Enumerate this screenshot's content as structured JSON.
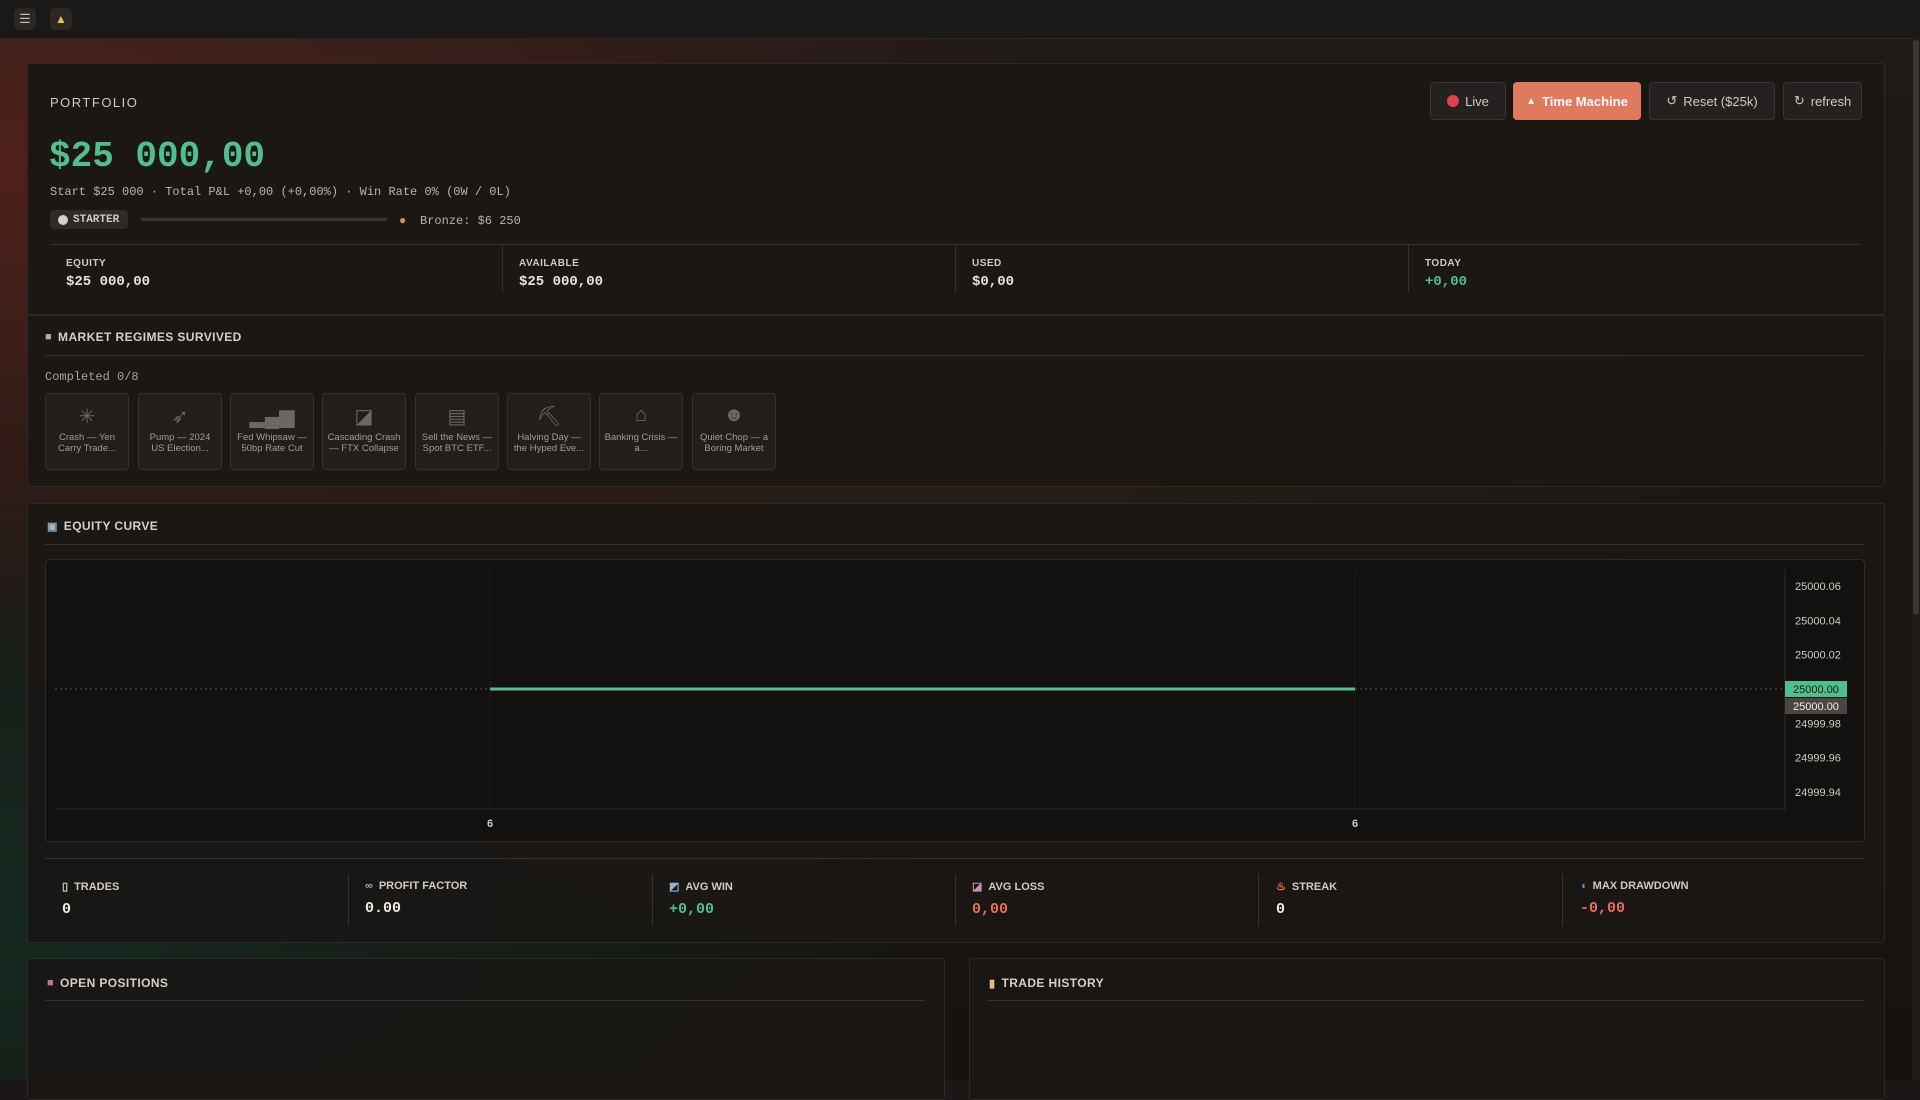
{
  "topbar": {
    "menu_icon": "☰",
    "bell_icon": "🔔"
  },
  "portfolio": {
    "title": "PORTFOLIO",
    "balance": "$25 000,00",
    "summary": "Start $25 000 · Total P&L +0,00 (+0,00%) · Win Rate 0% (0W / 0L)",
    "tier_badge": "STARTER",
    "tier_progress": 0,
    "next_tier": "Bronze: $6 250",
    "buttons": {
      "live": "Live",
      "time_machine": "Time Machine",
      "reset": "Reset ($25k)",
      "refresh": "refresh"
    },
    "metrics": [
      {
        "label": "EQUITY",
        "value": "$25 000,00"
      },
      {
        "label": "AVAILABLE",
        "value": "$25 000,00"
      },
      {
        "label": "USED",
        "value": "$0,00"
      },
      {
        "label": "TODAY",
        "value": "+0,00"
      }
    ]
  },
  "regimes": {
    "title": "MARKET REGIMES SURVIVED",
    "completed": "Completed 0/8",
    "items": [
      {
        "line1": "Crash — Yen",
        "line2": "Carry Trade...",
        "icon": "spark-icon"
      },
      {
        "line1": "Pump — 2024",
        "line2": "US Election...",
        "icon": "rocket-icon"
      },
      {
        "line1": "Fed Whipsaw —",
        "line2": "50bp Rate Cut",
        "icon": "bar-chart-icon"
      },
      {
        "line1": "Cascading Crash",
        "line2": "— FTX Collapse",
        "icon": "chart-down-icon"
      },
      {
        "line1": "Sell the News —",
        "line2": "Spot BTC ETF...",
        "icon": "newspaper-icon"
      },
      {
        "line1": "Halving Day —",
        "line2": "the Hyped Eve...",
        "icon": "pickaxe-icon"
      },
      {
        "line1": "Banking Crisis —",
        "line2": "a...",
        "icon": "bank-icon"
      },
      {
        "line1": "Quiet Chop — a",
        "line2": "Boring Market",
        "icon": "face-icon"
      }
    ]
  },
  "equity": {
    "title": "EQUITY CURVE",
    "y_ticks": [
      "25000.06",
      "25000.04",
      "25000.02",
      "25000.00",
      "24999.98",
      "24999.96",
      "24999.94"
    ],
    "x_ticks": [
      "6",
      "6"
    ],
    "price_tag_last": "25000.00",
    "price_tag_base": "25000.00"
  },
  "chart_data": {
    "type": "line",
    "title": "EQUITY CURVE",
    "x": [
      "6",
      "6"
    ],
    "series": [
      {
        "values": [
          25000.0,
          25000.0
        ]
      }
    ],
    "ylim": [
      24999.93,
      25000.07
    ],
    "baseline": 25000.0,
    "grid": false
  },
  "stats": [
    {
      "label": "TRADES",
      "value": "0",
      "icon": "document-icon",
      "color": "#eeeae5"
    },
    {
      "label": "PROFIT FACTOR",
      "value": "0.00",
      "icon": "binoculars-icon",
      "color": "#eeeae5"
    },
    {
      "label": "AVG WIN",
      "value": "+0,00",
      "icon": "chart-up-icon",
      "color": "#4fc08d"
    },
    {
      "label": "AVG LOSS",
      "value": "0,00",
      "icon": "chart-down-icon",
      "color": "#e8705a"
    },
    {
      "label": "STREAK",
      "value": "0",
      "icon": "fire-icon",
      "color": "#eeeae5"
    },
    {
      "label": "MAX DRAWDOWN",
      "value": "-0,00",
      "icon": "wave-icon",
      "color": "#e8705a"
    }
  ],
  "open_positions": {
    "title": "OPEN POSITIONS"
  },
  "trade_history": {
    "title": "TRADE HISTORY"
  },
  "colors": {
    "accent_green": "#4fc08d",
    "accent_red": "#e8705a",
    "time_machine": "#e07a5f",
    "live_dot": "#e04050"
  }
}
